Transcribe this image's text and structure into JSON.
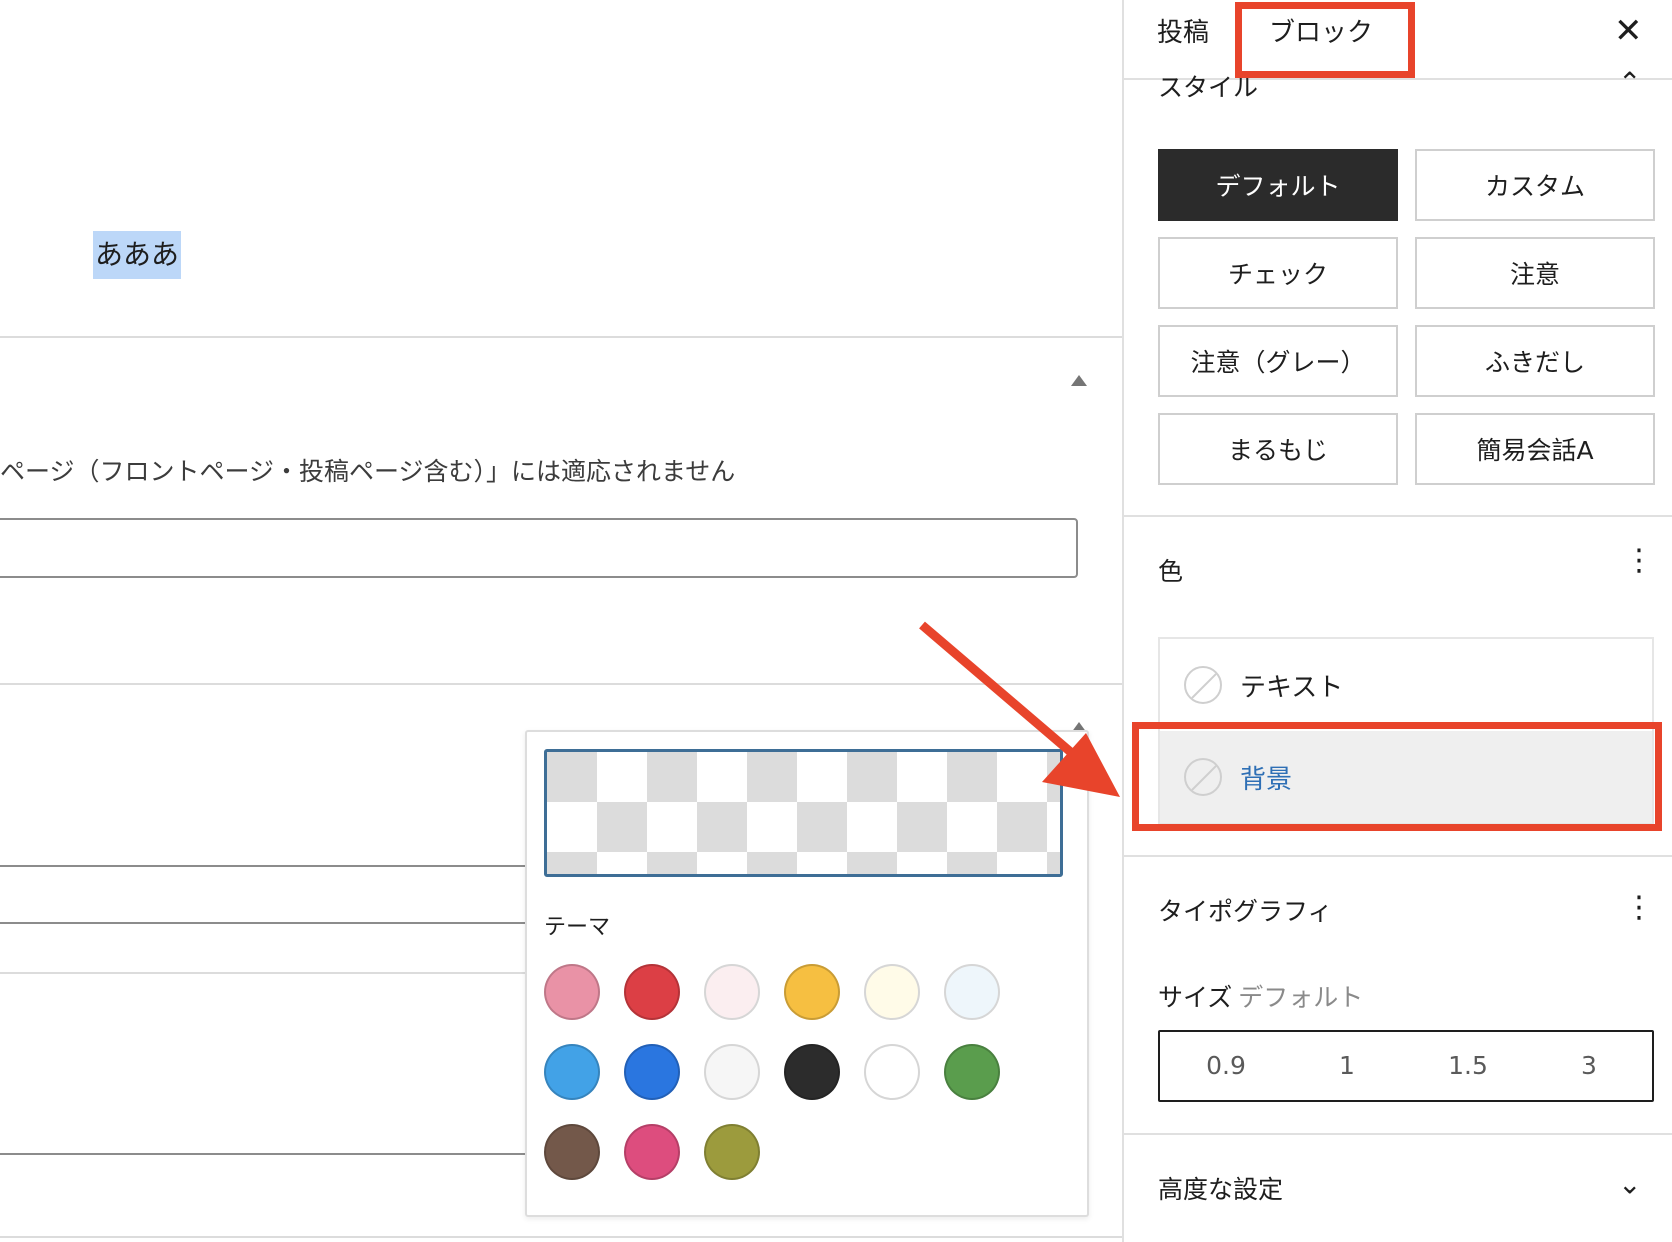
{
  "editor": {
    "selected_text": "あああ",
    "notice_text": "ページ（フロントページ・投稿ページ含む）」には適応されません"
  },
  "color_popover": {
    "palette_label": "テーマ",
    "swatches": [
      {
        "name": "pink",
        "color": "#e992a6"
      },
      {
        "name": "red",
        "color": "#dc3f45"
      },
      {
        "name": "pale-pink",
        "color": "#fbeef0"
      },
      {
        "name": "yellow",
        "color": "#f6bf41"
      },
      {
        "name": "pale-yellow",
        "color": "#fffbe8"
      },
      {
        "name": "pale-blue",
        "color": "#eef6fb"
      },
      {
        "name": "light-blue",
        "color": "#42a2e7"
      },
      {
        "name": "blue",
        "color": "#2a76e0"
      },
      {
        "name": "pale-gray",
        "color": "#f6f6f6"
      },
      {
        "name": "black",
        "color": "#2c2c2c"
      },
      {
        "name": "white",
        "color": "#ffffff"
      },
      {
        "name": "green",
        "color": "#5a9d4d"
      },
      {
        "name": "brown",
        "color": "#73584a"
      },
      {
        "name": "magenta",
        "color": "#dd4d7e"
      },
      {
        "name": "olive",
        "color": "#9c9b3d"
      }
    ]
  },
  "sidebar": {
    "tabs": {
      "post": "投稿",
      "block": "ブロック"
    },
    "close_symbol": "✕",
    "style_section": {
      "title": "スタイル",
      "buttons": [
        "デフォルト",
        "カスタム",
        "チェック",
        "注意",
        "注意（グレー）",
        "ふきだし",
        "まるもじ",
        "簡易会話A"
      ],
      "active": "デフォルト"
    },
    "color_section": {
      "title": "色",
      "text_label": "テキスト",
      "background_label": "背景"
    },
    "typography_section": {
      "title": "タイポグラフィ",
      "size_label": "サイズ",
      "size_value": "デフォルト",
      "size_options": [
        "0.9",
        "1",
        "1.5",
        "3"
      ]
    },
    "advanced_section": {
      "title": "高度な設定"
    }
  },
  "colors": {
    "annotation_red": "#e8442b",
    "active_text_blue": "#2e6fb5",
    "selection_blue": "#bcd7f8"
  }
}
